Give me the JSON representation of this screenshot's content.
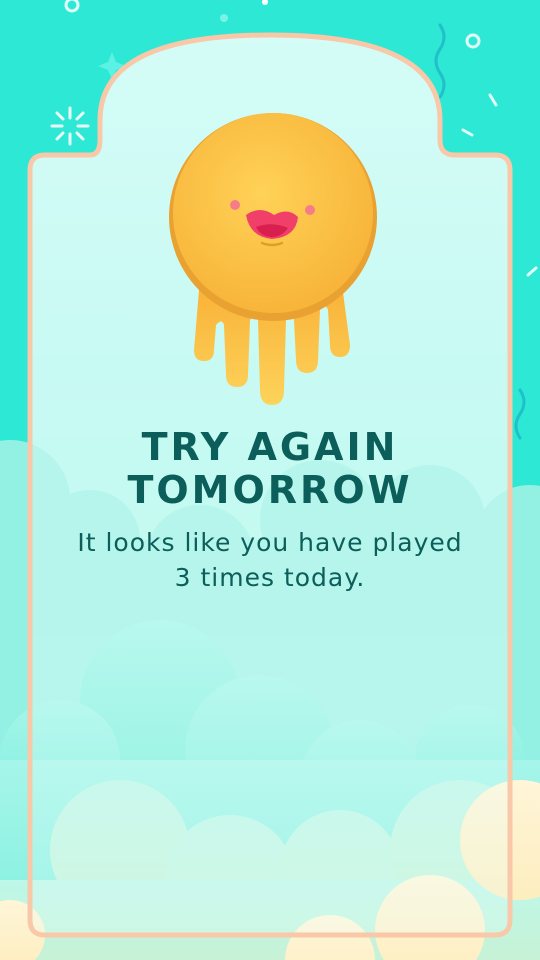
{
  "screen": {
    "title_line1": "TRY AGAIN",
    "title_line2": "TOMORROW",
    "message_line1": "It looks like you have played",
    "message_line2": "3 times today."
  },
  "mascot": {
    "icon": "sun-mascot-icon",
    "expression": "smiling"
  },
  "colors": {
    "background": "#2de8d4",
    "card_fill": "#c8f8f0",
    "card_border": "#f8c8a8",
    "text": "#0b5e59",
    "sun": "#fbc040"
  }
}
